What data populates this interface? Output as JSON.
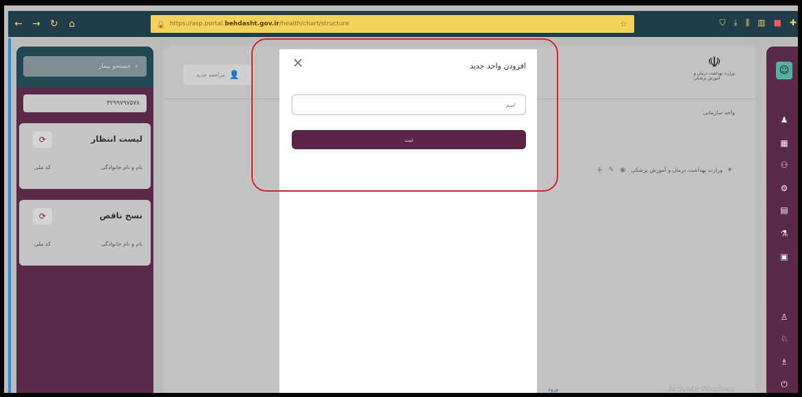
{
  "browser": {
    "url_prefix": "https://asp.portal.",
    "url_domain": "behdasht.gov.ir",
    "url_suffix": "/health/chart/structure"
  },
  "left_panel": {
    "search_placeholder": "جستجو بیمار",
    "select_value": "۳۲۹۹۷۹۷۵۷۸",
    "cards": [
      {
        "title": "لیست انتظار",
        "col_name": "نام و نام خانوادگی",
        "col_id": "کد ملی"
      },
      {
        "title": "نسخ ناقص",
        "col_name": "نام و نام خانوادگی",
        "col_id": "کد ملی"
      }
    ]
  },
  "main": {
    "tab_label": "مراجعه جدید",
    "logo_text": "وزارت بهداشت درمان و آموزش پزشکی",
    "org_label": "واحد سازمانی",
    "tree_item": "وزارت بهداشت درمان و آموزش پزشکی",
    "watermark": "Activate Windows",
    "bottom_link": "ورود"
  },
  "modal": {
    "title": "افزودن واحد جدید",
    "input_placeholder": "اسم",
    "submit_label": "ثبت"
  },
  "colors": {
    "sidebar_purple": "#5a2a48",
    "sidebar_teal": "#1f4854",
    "button_purple": "#5b2447",
    "highlight_red": "#e11a2a",
    "urlbar_yellow": "#f5d35a"
  }
}
